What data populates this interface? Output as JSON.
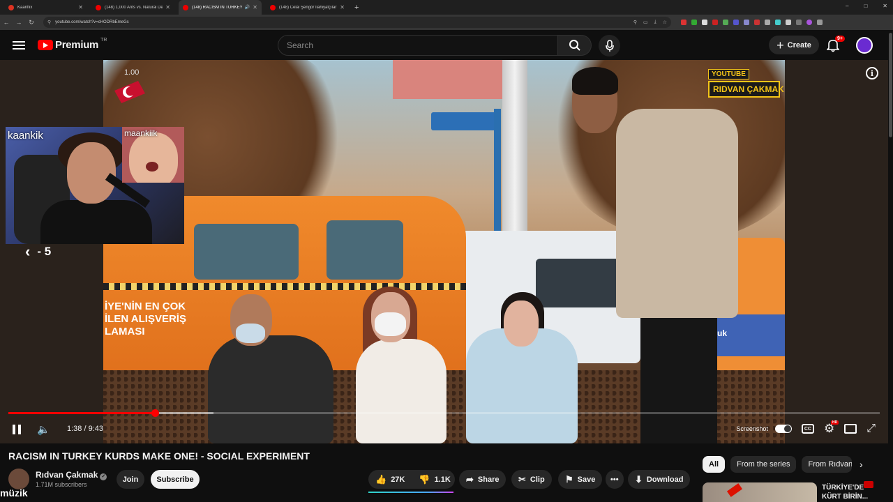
{
  "browser": {
    "tabs": [
      {
        "title": "Kaanflix",
        "active": false
      },
      {
        "title": "(148) 1,000 Ants vs. Natural De",
        "active": false
      },
      {
        "title": "(148) RACISM IN TURKEY K",
        "active": true
      },
      {
        "title": "(148) Celal Şengör İlahiyatçılar",
        "active": false
      }
    ],
    "new_tab": "+",
    "url": "youtube.com/watch?v=cHODRbEmeGs",
    "window_controls": [
      "–",
      "□",
      "✕"
    ]
  },
  "header": {
    "logo_text": "Premium",
    "region": "TR",
    "search_placeholder": "Search",
    "create_label": "Create",
    "notifications_badge": "9+"
  },
  "player": {
    "speed_overlay": "1.00",
    "watermark_top": "YOUTUBE",
    "watermark_name": "RIDVAN ÇAKMAK",
    "taxi_ad_lines": [
      "İYE'NİN EN ÇOK",
      "İLEN ALIŞVERİŞ",
      "LAMASI"
    ],
    "van_ad": "bi mutluluk",
    "facecam_label": "kaankik",
    "facecam2_label": "maankiik",
    "seek_label": "- 5",
    "time": "1:38 / 9:43",
    "progress_fraction": 0.168,
    "buffer_fraction": 0.235,
    "screenshot_label": "Screenshot",
    "cc_label": "CC",
    "hd_badge": "HD"
  },
  "video": {
    "title": "RACISM IN TURKEY KURDS MAKE ONE! - SOCIAL EXPERIMENT",
    "channel": "Rıdvan Çakmak",
    "subscribers": "1.71M subscribers",
    "join_label": "Join",
    "subscribe_label": "Subscribe",
    "likes": "27K",
    "dislikes": "1.1K",
    "share_label": "Share",
    "clip_label": "Clip",
    "save_label": "Save",
    "more_label": "•••",
    "download_label": "Download"
  },
  "overlay_text": "müzik",
  "chips": [
    "All",
    "From the series",
    "From Rıdvan Ça"
  ],
  "recommendation": {
    "title_line1": "TÜRKİYE'DE",
    "title_line2": "KÜRT BİRİN..."
  }
}
